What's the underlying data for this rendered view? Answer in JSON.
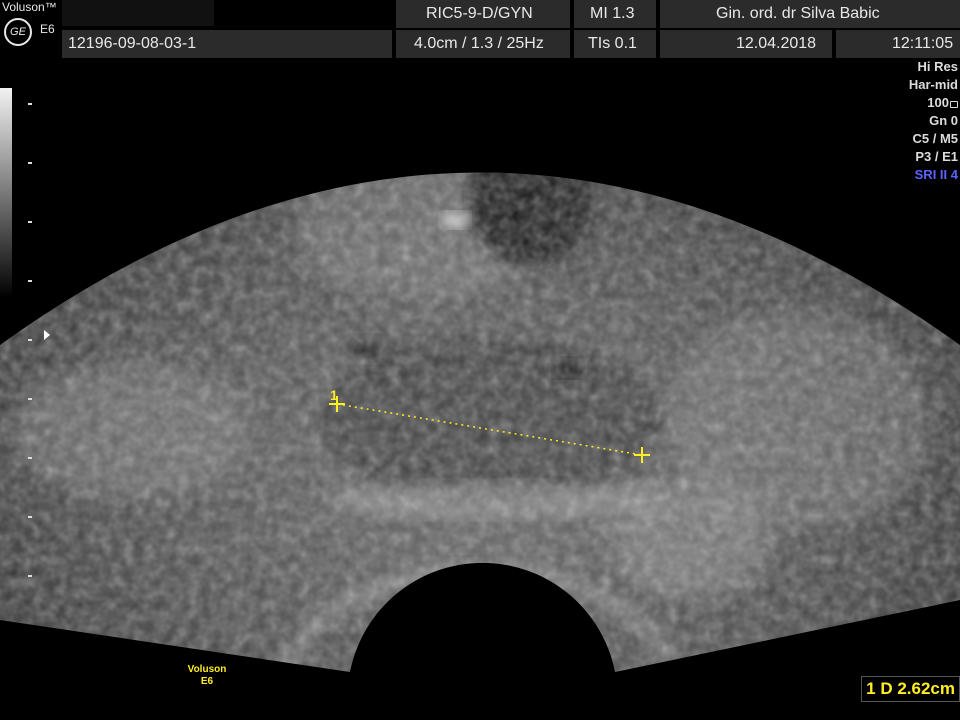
{
  "header": {
    "brand": "Voluson™",
    "ge_logo": "GE",
    "model": "E6",
    "patient_id": "12196-09-08-03-1",
    "probe": "RIC5-9-D/GYN",
    "depth_info": "4.0cm / 1.3 / 25Hz",
    "mi": "MI  1.3",
    "tis": "TIs  0.1",
    "institution": "Gin. ord. dr Silva Babic",
    "date": "12.04.2018",
    "time": "12:11:05"
  },
  "settings": {
    "resolution": "Hi Res",
    "harmonic": "Har-mid",
    "power": "100",
    "gain": "Gn   0",
    "c_m": "C5 / M5",
    "p_e": "P3 / E1",
    "sri": "SRI II 4"
  },
  "measurement": {
    "caliper_label": "1",
    "result": "1  D 2.62cm",
    "color": "#ffee22"
  },
  "footer": {
    "brand_line1": "Voluson",
    "brand_line2": "E6"
  },
  "icons": {
    "lock": "lock-icon",
    "caliper": "caliper-cross-icon",
    "focus": "focus-arrow-icon"
  }
}
